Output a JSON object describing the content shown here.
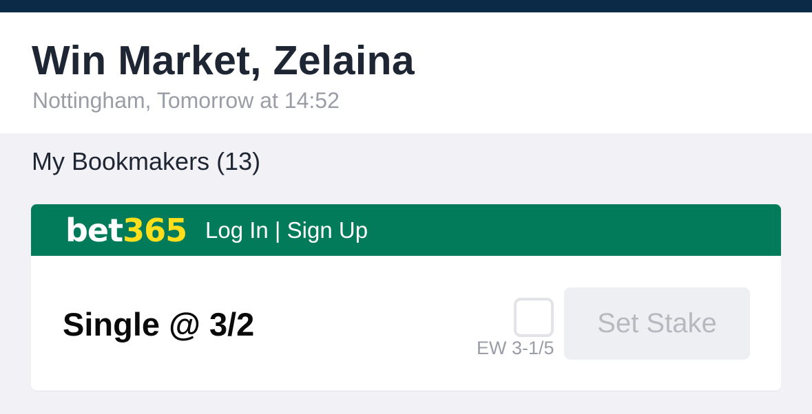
{
  "market": {
    "title": "Win Market, Zelaina",
    "subtitle": "Nottingham, Tomorrow at 14:52"
  },
  "bookmakers": {
    "section_label": "My Bookmakers (13)"
  },
  "card": {
    "logo_bet": "bet",
    "logo_num": "365",
    "auth_links": "Log In | Sign Up",
    "bet_type": "Single @ 3/2",
    "ew_label": "EW 3-1/5",
    "stake_button": "Set Stake"
  },
  "colors": {
    "top_bar": "#0b2a47",
    "brand_green": "#027b5b",
    "brand_yellow": "#ffdf1b"
  }
}
